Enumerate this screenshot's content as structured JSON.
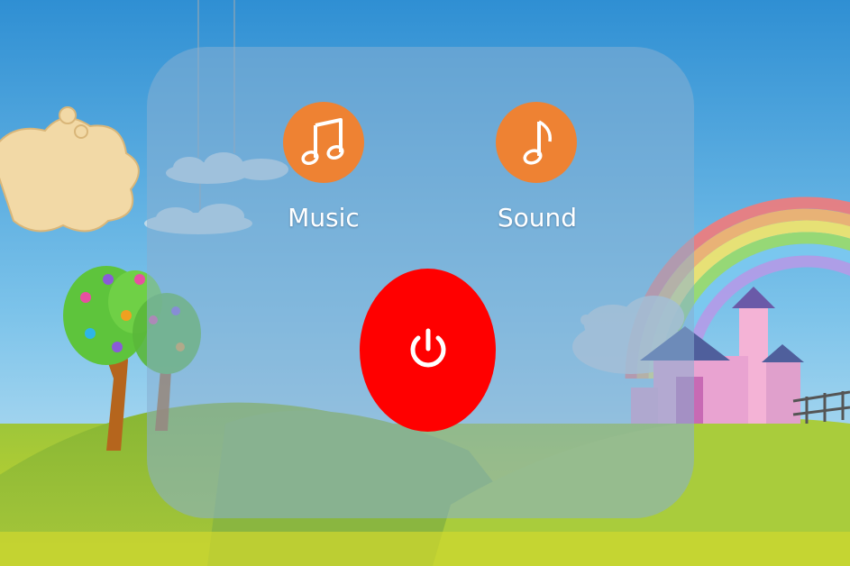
{
  "settings": {
    "music_label": "Music",
    "sound_label": "Sound"
  },
  "icons": {
    "music": "beamed-notes-icon",
    "sound": "single-note-icon",
    "power": "power-icon"
  },
  "colors": {
    "option_button": "#ee8233",
    "power_button": "#ff0000",
    "sky_top": "#3a97d8",
    "grass": "#9cc234"
  }
}
